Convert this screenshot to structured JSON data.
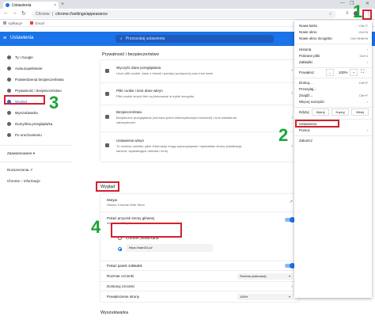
{
  "browser": {
    "tab_title": "Ustawienia",
    "tab_close": "×",
    "new_tab": "+",
    "window_controls": [
      "—",
      "❐",
      "✕"
    ],
    "nav": {
      "back": "←",
      "forward": "→",
      "reload": "↻"
    },
    "omnibox_site": "Chrome",
    "omnibox_separator": "|",
    "omnibox_url": "chrome://settings/appearance",
    "bookmarks": [
      "Aplikacje",
      "Gmail"
    ]
  },
  "settings": {
    "title": "Ustawienia",
    "search_placeholder": "Przeszukaj ustawienia"
  },
  "sidebar": {
    "items": [
      {
        "label": "Ty i Google"
      },
      {
        "label": "Autouzupełnianie"
      },
      {
        "label": "Potwierdzenia bezpieczeństwa"
      },
      {
        "label": "Prywatność i bezpieczeństwo"
      },
      {
        "label": "Wygląd"
      },
      {
        "label": "Wyszukiwarka"
      },
      {
        "label": "Domyślna przeglądarka"
      },
      {
        "label": "Po uruchomieniu"
      }
    ],
    "advanced": "Zaawansowane",
    "extensions": "Rozszerzenia",
    "about": "Chrome – informacje"
  },
  "privacy": {
    "heading": "Prywatność i bezpieczeństwo",
    "rows": [
      {
        "title": "Wyczyść dane przeglądania",
        "sub": "Usuń pliki cookie, dane z historii i pamięci podręcznej oraz inne dane"
      },
      {
        "title": "Pliki cookie i inne dane witryn",
        "sub": "Pliki cookie innych firm są blokowane w trybie incognito"
      },
      {
        "title": "Bezpieczeństwo",
        "sub": "Bezpieczne przeglądanie (ochrona przed niebezpiecznymi stronami) i inne ustawienia",
        "sub2": "zabezpieczeń"
      },
      {
        "title": "Ustawienia witryn",
        "sub": "Tu możesz określić, jakie informacje mogą wykorzystywać i wyświetlać strony (lokalizacja,",
        "sub2": "kamera, wyskakujące okienka i inne)"
      }
    ]
  },
  "appearance": {
    "heading": "Wygląd",
    "themes_title": "Motyw",
    "themes_sub": "Otwórz Chrome Web Store",
    "home_title": "Pokaż przycisk strony głównej",
    "home_sub": "https://start24.pl/",
    "radio_newtab": "Chrome „Nowa karta\"",
    "radio_url_value": "https://start24.pl/",
    "bookmarks_bar": "Pokaż pasek zakładek",
    "font_size_label": "Rozmiar czcionki",
    "font_size_value": "Średnia (zalecana)",
    "customize_fonts": "Dostosuj czcionki",
    "zoom_label": "Powiększenie strony",
    "zoom_value": "100%"
  },
  "search_section": {
    "heading": "Wyszukiwarka"
  },
  "menu": {
    "items_top": [
      "Nowa karta",
      "Nowe okno",
      "Nowe okno incognito"
    ],
    "shortcuts_top": [
      "Ctrl+T",
      "Ctrl+N",
      "Ctrl+Shift+N"
    ],
    "items_mid": [
      "Historia",
      "Pobrane pliki",
      "Zakładki"
    ],
    "shortcuts_mid": [
      "",
      "Ctrl+J",
      ""
    ],
    "zoom_label": "Powiększ",
    "zoom_minus": "–",
    "zoom_value": "100%",
    "zoom_plus": "+",
    "items_print": [
      "Drukuj...",
      "Przesyłaj...",
      "Znajdź...",
      "Więcej narzędzi"
    ],
    "shortcuts_print": [
      "Ctrl+P",
      "",
      "Ctrl+F",
      ""
    ],
    "edit_label": "Edytuj",
    "edit_cut": "Wytnij",
    "edit_copy": "Kopiuj",
    "edit_paste": "Wklej",
    "settings": "Ustawienia",
    "help": "Pomoc",
    "exit": "Zakończ"
  },
  "annotations": {
    "step1": "1",
    "step2": "2",
    "step3": "3",
    "step4": "4"
  },
  "colors": {
    "accent": "#1a73e8",
    "highlight": "#d3202f",
    "step_number": "#1aa33a"
  }
}
